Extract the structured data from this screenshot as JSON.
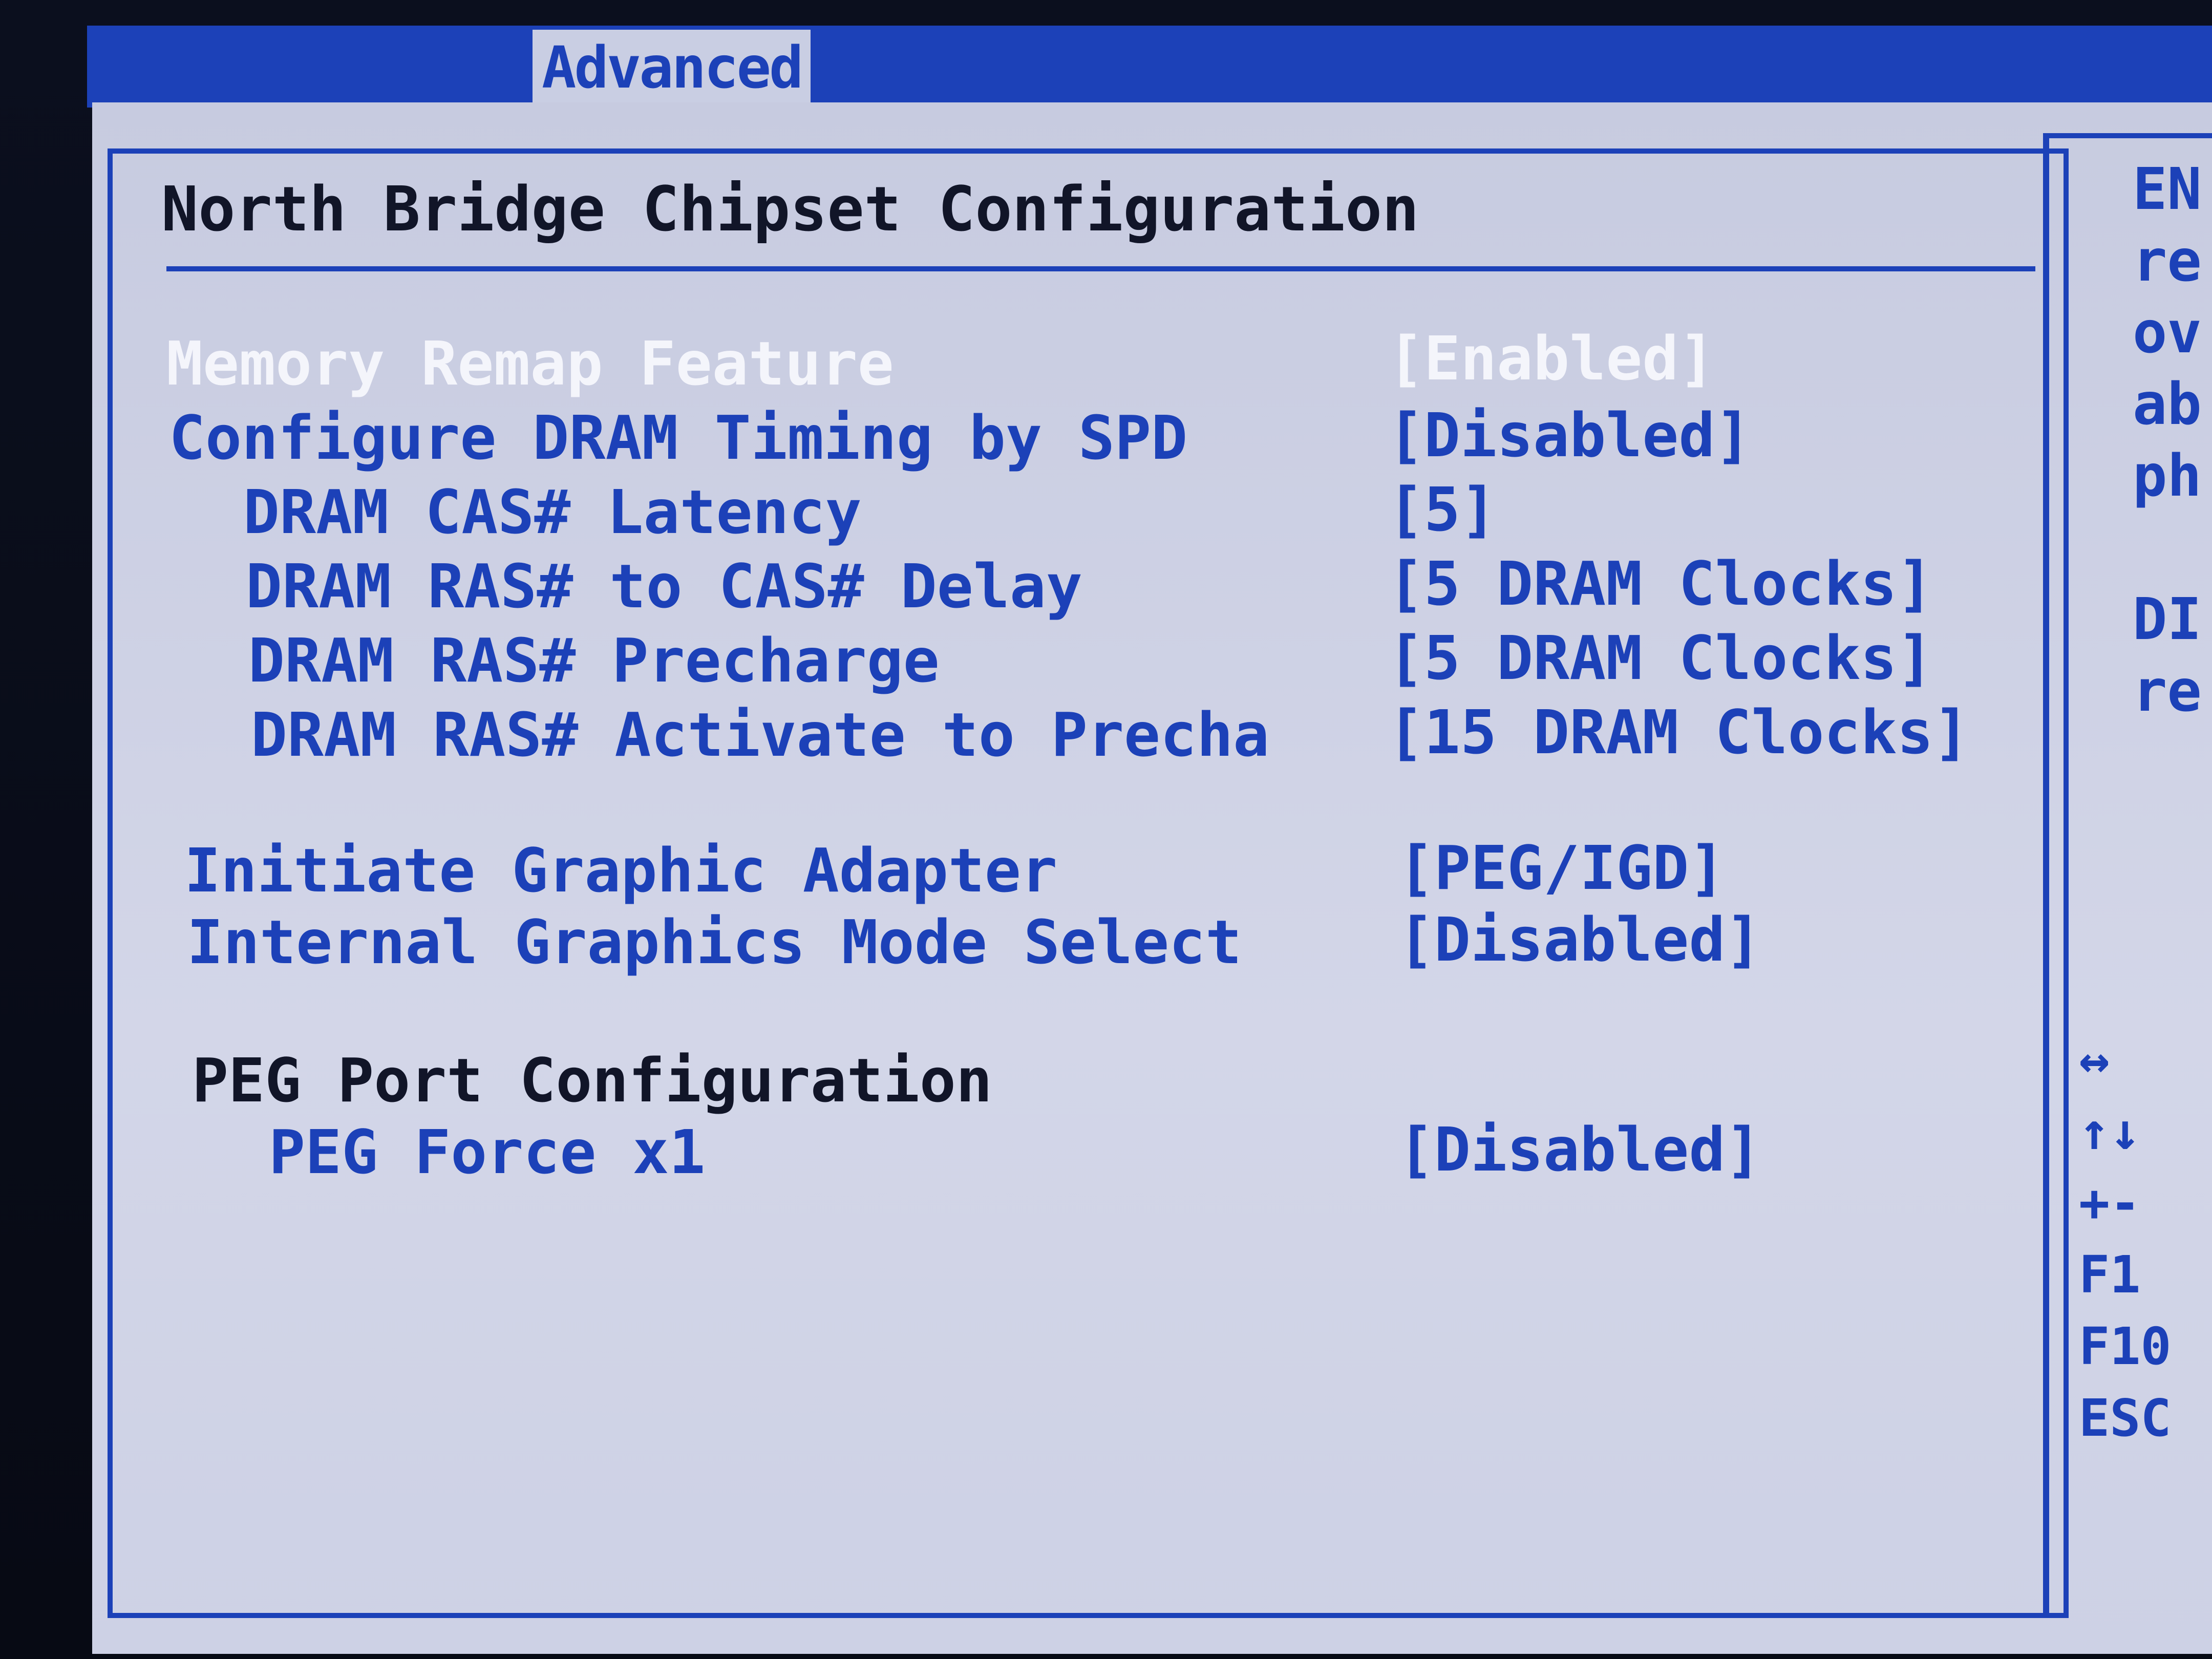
{
  "menu": {
    "active_tab": "Advanced"
  },
  "title": "North Bridge Chipset Configuration",
  "settings": [
    {
      "label": "Memory Remap Feature",
      "value": "[Enabled]"
    },
    {
      "label": "Configure DRAM Timing by SPD",
      "value": "[Disabled]"
    },
    {
      "label": "DRAM CAS# Latency",
      "value": "[5]"
    },
    {
      "label": "DRAM RAS# to CAS# Delay",
      "value": "[5 DRAM Clocks]"
    },
    {
      "label": "DRAM RAS# Precharge",
      "value": "[5 DRAM Clocks]"
    },
    {
      "label": "DRAM RAS# Activate to Precha",
      "value": "[15 DRAM Clocks]"
    },
    {
      "label": "Initiate Graphic Adapter",
      "value": "[PEG/IGD]"
    },
    {
      "label": "Internal Graphics Mode Select",
      "value": "[Disabled]"
    }
  ],
  "peg_section": {
    "heading": "PEG Port Configuration",
    "items": [
      {
        "label": "PEG Force x1",
        "value": "[Disabled]"
      }
    ]
  },
  "help_text": [
    "EN",
    "re",
    "ov",
    "ab",
    "ph",
    "",
    "DI",
    "re"
  ],
  "key_legend": [
    "↔",
    "↑↓",
    "+-",
    "F1",
    "F10",
    "ESC"
  ],
  "colors": {
    "bios_blue": "#1c41b8",
    "panel_gray": "#cdd1e5",
    "selected_white": "#f4f5fb"
  }
}
